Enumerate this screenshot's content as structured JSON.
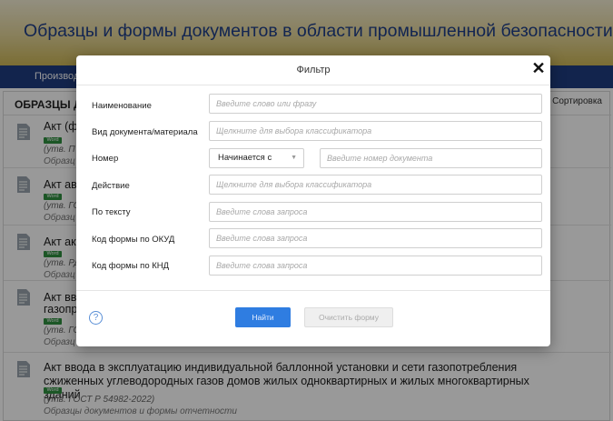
{
  "header": {
    "title": "Образцы и формы документов в области промышленной безопасности"
  },
  "nav": {
    "item": "Производ"
  },
  "list": {
    "title": "ОБРАЗЦЫ Д",
    "sort_label": "Сортировка",
    "items": [
      {
        "title": "Акт (фо",
        "badge": "Word",
        "std": "(утв. П",
        "cat": "Образц"
      },
      {
        "title": "Акт ава",
        "badge": "Word",
        "std": "(утв. ГОС",
        "cat": "Образц"
      },
      {
        "title": "Акт аку",
        "badge": "Word",
        "std": "(утв. РД",
        "cat": "Образц"
      },
      {
        "title": "Акт ввод",
        "title2": "газопро",
        "badge": "Word",
        "std": "(утв. ГОС",
        "cat": "Образц"
      },
      {
        "title": "Акт ввода в эксплуатацию индивидуальной баллонной установки и сети газопотребления сжиженных углеводородных газов домов жилых одноквартирных и жилых многоквартирных зданий",
        "badge": "Word",
        "std": "(утв. ГОСТ Р 54982-2022)",
        "cat": "Образцы документов и формы отчетности"
      }
    ]
  },
  "modal": {
    "title": "Фильтр",
    "close": "✕",
    "fields": {
      "name": {
        "label": "Наименование",
        "placeholder": "Введите слово или фразу"
      },
      "doctype": {
        "label": "Вид документа/материала",
        "placeholder": "Щелкните для выбора классификатора"
      },
      "number": {
        "label": "Номер",
        "select": "Начинается с",
        "placeholder": "Введите номер документа"
      },
      "action": {
        "label": "Действие",
        "placeholder": "Щелкните для выбора классификатора"
      },
      "text": {
        "label": "По тексту",
        "placeholder": "Введите слова запроса"
      },
      "okud": {
        "label": "Код формы по ОКУД",
        "placeholder": "Введите слова запроса"
      },
      "knd": {
        "label": "Код формы по КНД",
        "placeholder": "Введите слова запроса"
      }
    },
    "help": "?",
    "find_button": "Найти",
    "clear_button": "Очистить форму"
  },
  "colors": {
    "nav": "#1e3c80",
    "header_title": "#1f3e88",
    "find_button": "#2f7de1",
    "badge": "#2f8f40"
  }
}
